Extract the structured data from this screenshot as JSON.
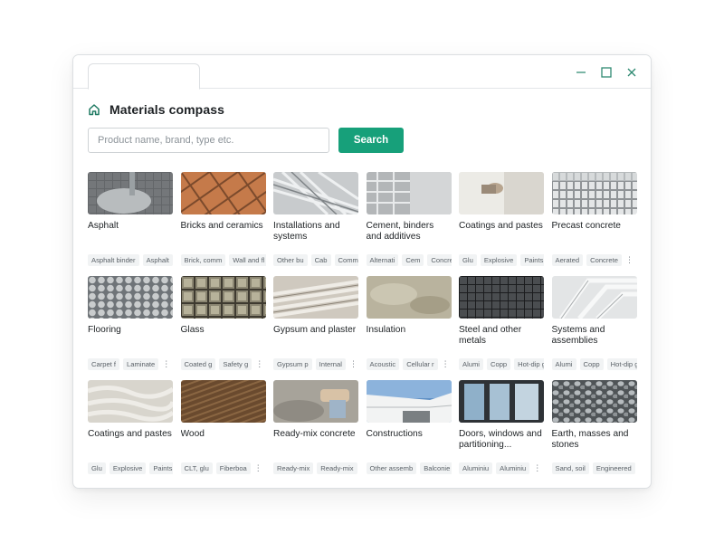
{
  "app": {
    "title": "Materials compass"
  },
  "search": {
    "placeholder": "Product name, brand, type etc.",
    "button_label": "Search"
  },
  "colors": {
    "accent": "#17a07a",
    "icon": "#2f8a72"
  },
  "categories": [
    {
      "name": "Asphalt",
      "tags": [
        "Asphalt binder",
        "Asphalt"
      ],
      "more": false,
      "thumb": "asphalt"
    },
    {
      "name": "Bricks and ceramics",
      "tags": [
        "Brick, comm",
        "Wall and fl"
      ],
      "more": false,
      "thumb": "bricks"
    },
    {
      "name": "Installations and systems",
      "tags": [
        "Other bu",
        "Cab",
        "Commu"
      ],
      "more": false,
      "thumb": "installations"
    },
    {
      "name": "Cement, binders and additives",
      "tags": [
        "Alternati",
        "Cem",
        "Concre"
      ],
      "more": false,
      "thumb": "cement"
    },
    {
      "name": "Coatings and pastes",
      "tags": [
        "Glu",
        "Explosive",
        "Paints,"
      ],
      "more": false,
      "thumb": "coatings"
    },
    {
      "name": "Precast concrete",
      "tags": [
        "Aerated",
        "Concrete"
      ],
      "more": true,
      "thumb": "precast"
    },
    {
      "name": "Flooring",
      "tags": [
        "Carpet f",
        "Laminate"
      ],
      "more": true,
      "thumb": "flooring"
    },
    {
      "name": "Glass",
      "tags": [
        "Coated g",
        "Safety g"
      ],
      "more": true,
      "thumb": "glass"
    },
    {
      "name": "Gypsum and plaster",
      "tags": [
        "Gypsum p",
        "Internal"
      ],
      "more": true,
      "thumb": "gypsum"
    },
    {
      "name": "Insulation",
      "tags": [
        "Acoustic",
        "Cellular r"
      ],
      "more": true,
      "thumb": "insulation"
    },
    {
      "name": "Steel and other metals",
      "tags": [
        "Alumi",
        "Copp",
        "Hot-dip g"
      ],
      "more": false,
      "thumb": "steel"
    },
    {
      "name": "Systems and assemblies",
      "tags": [
        "Alumi",
        "Copp",
        "Hot-dip g"
      ],
      "more": false,
      "thumb": "systems"
    },
    {
      "name": "Coatings and pastes",
      "tags": [
        "Glu",
        "Explosive",
        "Paints,"
      ],
      "more": false,
      "thumb": "coatings2"
    },
    {
      "name": "Wood",
      "tags": [
        "CLT, glu",
        "Fiberboa"
      ],
      "more": true,
      "thumb": "wood"
    },
    {
      "name": "Ready-mix concrete",
      "tags": [
        "Ready-mix",
        "Ready-mix"
      ],
      "more": true,
      "thumb": "readymix"
    },
    {
      "name": "Constructions",
      "tags": [
        "Other assemb",
        "Balconie"
      ],
      "more": true,
      "thumb": "constructions"
    },
    {
      "name": "Doors, windows and partitioning...",
      "tags": [
        "Aluminiu",
        "Aluminiu"
      ],
      "more": true,
      "thumb": "doors"
    },
    {
      "name": "Earth, masses and stones",
      "tags": [
        "Sand, soil",
        "Engineered"
      ],
      "more": false,
      "thumb": "stones"
    }
  ]
}
